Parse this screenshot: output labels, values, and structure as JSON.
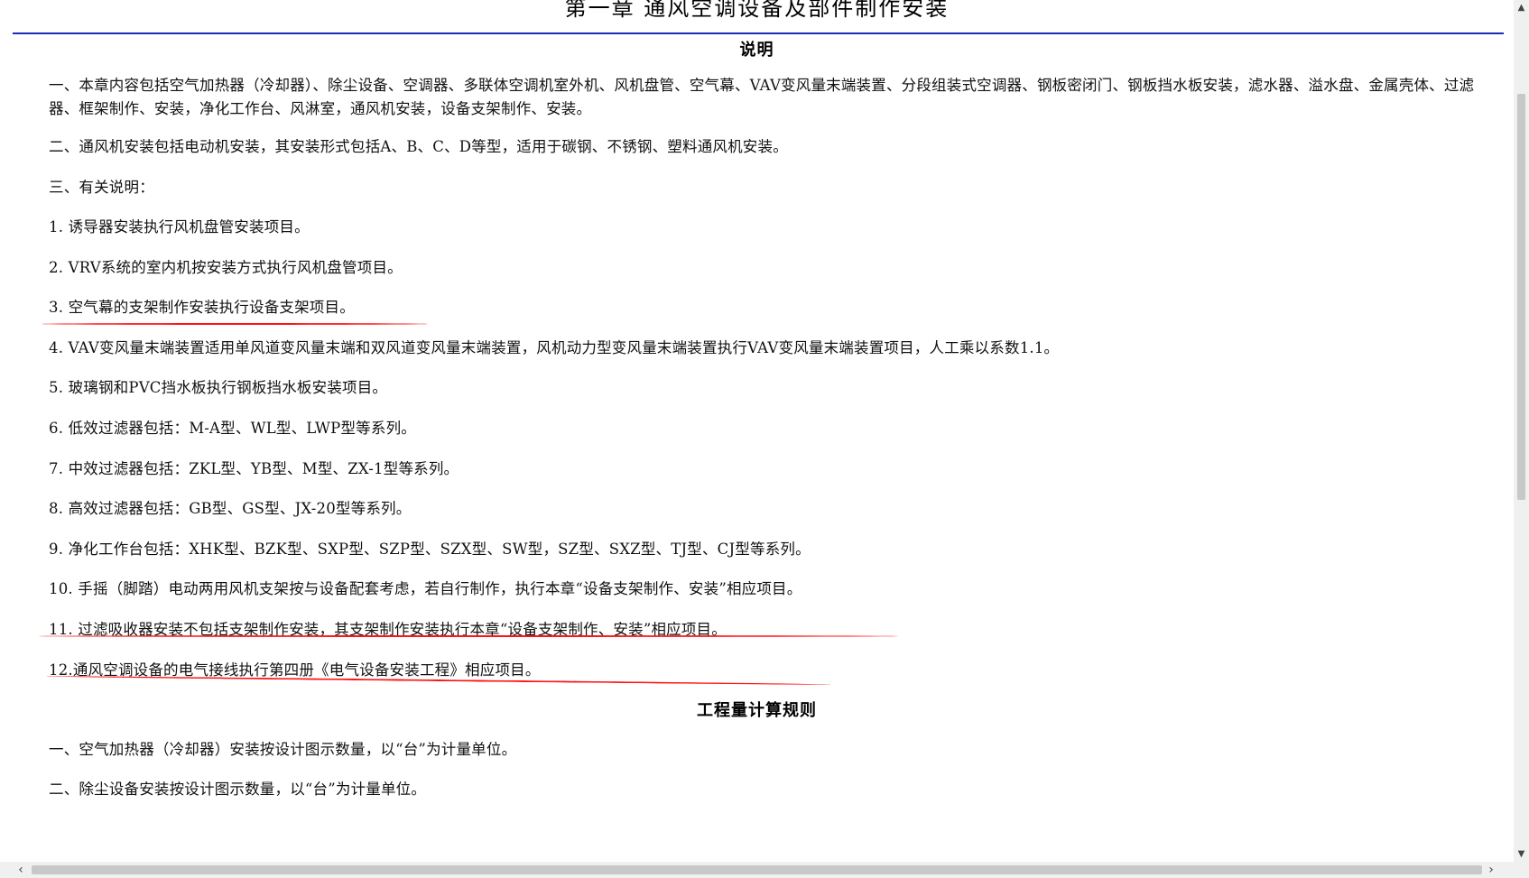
{
  "document": {
    "title": "第一章 通风空调设备及部件制作安装",
    "section_explanation": "说明",
    "paragraphs": [
      "一、本章内容包括空气加热器（冷却器）、除尘设备、空调器、多联体空调机室外机、风机盘管、空气幕、VAV变风量末端装置、分段组装式空调器、钢板密闭门、钢板挡水板安装，滤水器、溢水盘、金属壳体、过滤器、框架制作、安装，净化工作台、风淋室，通风机安装，设备支架制作、安装。",
      "二、通风机安装包括电动机安装，其安装形式包括A、B、C、D等型，适用于碳钢、不锈钢、塑料通风机安装。",
      "三、有关说明：",
      "1. 诱导器安装执行风机盘管安装项目。",
      "2. VRV系统的室内机按安装方式执行风机盘管项目。",
      "3. 空气幕的支架制作安装执行设备支架项目。",
      "4. VAV变风量末端装置适用单风道变风量末端和双风道变风量末端装置，风机动力型变风量末端装置执行VAV变风量末端装置项目，人工乘以系数1.1。",
      "5. 玻璃钢和PVC挡水板执行钢板挡水板安装项目。",
      "6. 低效过滤器包括：M-A型、WL型、LWP型等系列。",
      "7. 中效过滤器包括：ZKL型、YB型、M型、ZX-1型等系列。",
      "8. 高效过滤器包括：GB型、GS型、JX-20型等系列。",
      "9. 净化工作台包括：XHK型、BZK型、SXP型、SZP型、SZX型、SW型，SZ型、SXZ型、TJ型、CJ型等系列。",
      "10. 手摇（脚踏）电动两用风机支架按与设备配套考虑，若自行制作，执行本章“设备支架制作、安装”相应项目。",
      "11. 过滤吸收器安装不包括支架制作安装，其支架制作安装执行本章“设备支架制作、安装”相应项目。",
      "12.通风空调设备的电气接线执行第四册《电气设备安装工程》相应项目。"
    ],
    "section_rules": "工程量计算规则",
    "rules": [
      "一、空气加热器（冷却器）安装按设计图示数量，以“台”为计量单位。",
      "二、除尘设备安装按设计图示数量，以“台”为计量单位。"
    ]
  },
  "annotations": {
    "underline_color": "#ff1414",
    "underlined_items": [
      "3",
      "10",
      "11"
    ]
  },
  "colors": {
    "title_rule": "#1f2bb3",
    "background": "#ffffff",
    "scrollbar_track": "#f0f0f0",
    "scrollbar_thumb": "#c8c8c8"
  },
  "scrollbars": {
    "up_icon": "▲",
    "down_icon": "▼",
    "left_icon": "‹",
    "right_icon": "›"
  }
}
